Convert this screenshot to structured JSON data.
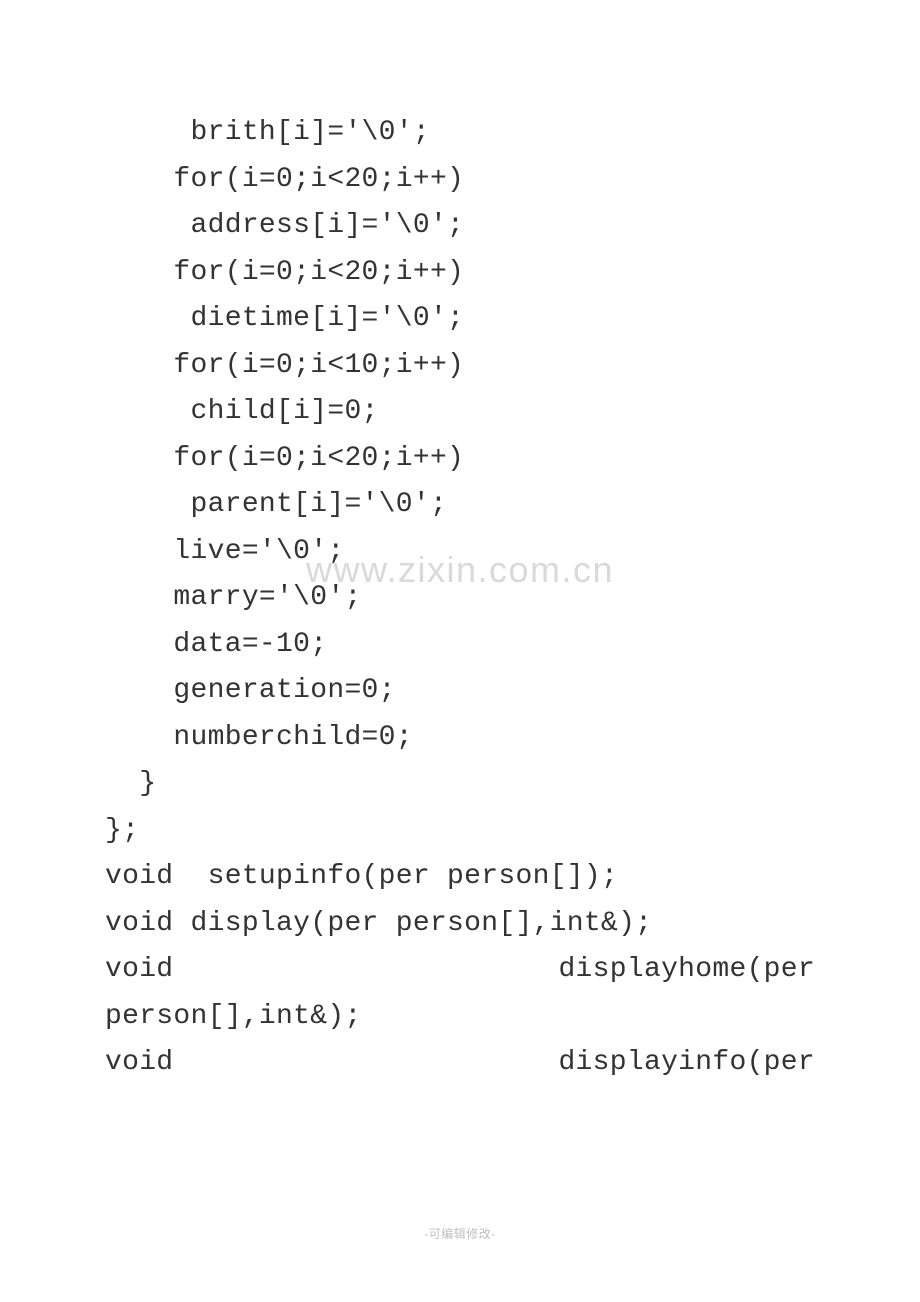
{
  "code": {
    "lines": [
      "     brith[i]='\\0';",
      "    for(i=0;i<20;i++)",
      "     address[i]='\\0';",
      "    for(i=0;i<20;i++)",
      "     dietime[i]='\\0';",
      "    for(i=0;i<10;i++)",
      "     child[i]=0;",
      "    for(i=0;i<20;i++)",
      "     parent[i]='\\0';",
      "    live='\\0';",
      "    marry='\\0';",
      "    data=-10;",
      "    generation=0;",
      "    numberchild=0;",
      "  }",
      "};",
      "",
      "void  setupinfo(per person[]);",
      "void display(per person[],int&);"
    ],
    "justified": [
      {
        "left": "void",
        "right": "displayhome(per"
      },
      {
        "left_plain": "person[],int&);"
      },
      {
        "left": "void",
        "right": "displayinfo(per"
      }
    ]
  },
  "watermark": "www.zixin.com.cn",
  "footer": "-可编辑修改-"
}
